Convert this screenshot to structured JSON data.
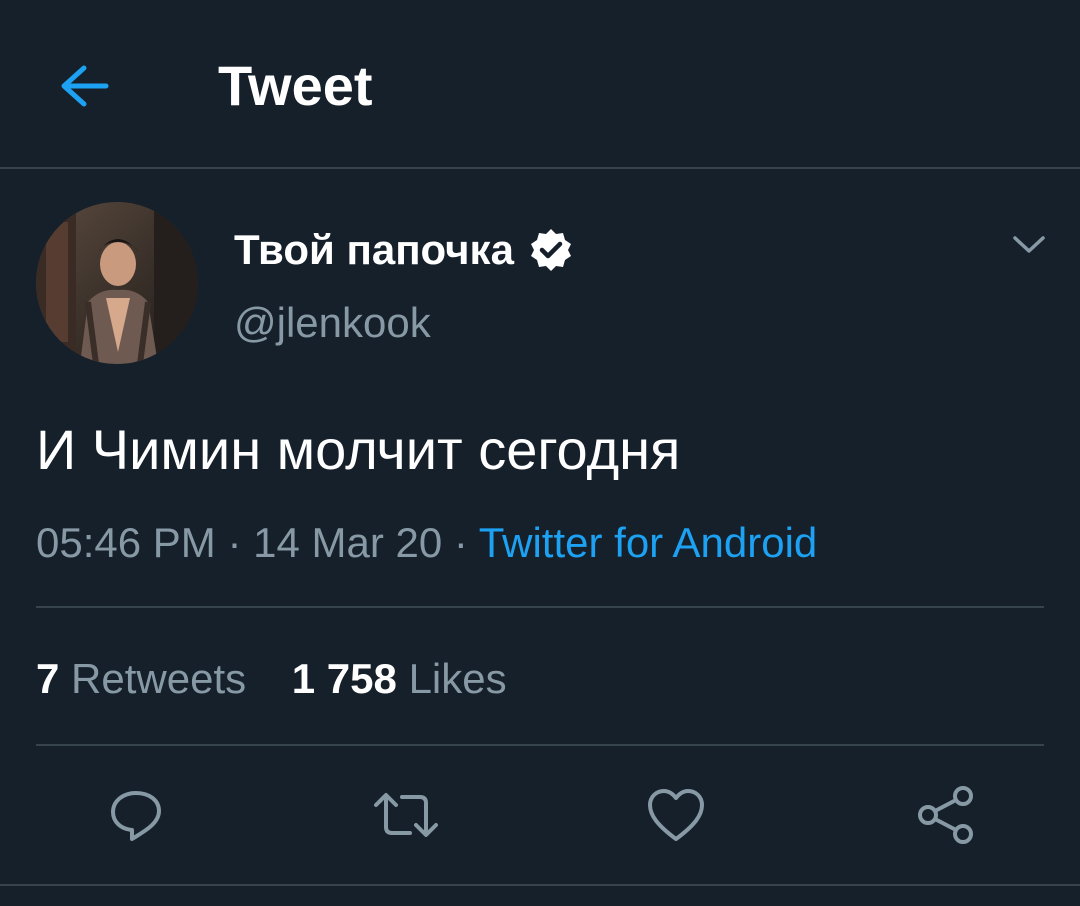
{
  "header": {
    "title": "Tweet",
    "back_icon": "back-arrow-icon"
  },
  "author": {
    "display_name": "Твой папочка",
    "handle": "@jlenkook",
    "verified": true,
    "verified_icon": "verified-badge-icon"
  },
  "tweet": {
    "text": "И Чимин молчит сегодня",
    "time": "05:46 PM",
    "separator": " · ",
    "date": "14 Mar 20",
    "source": "Twitter for Android"
  },
  "stats": {
    "retweets_count": "7",
    "retweets_label": "Retweets",
    "likes_count": "1 758",
    "likes_label": "Likes"
  },
  "actions": [
    {
      "name": "reply",
      "icon": "reply-icon"
    },
    {
      "name": "retweet",
      "icon": "retweet-icon"
    },
    {
      "name": "like",
      "icon": "like-icon"
    },
    {
      "name": "share",
      "icon": "share-icon"
    }
  ],
  "colors": {
    "background": "#15202b",
    "divider": "#38444d",
    "accent": "#1da1f2",
    "secondary_text": "#8899a6",
    "primary_text": "#ffffff"
  }
}
